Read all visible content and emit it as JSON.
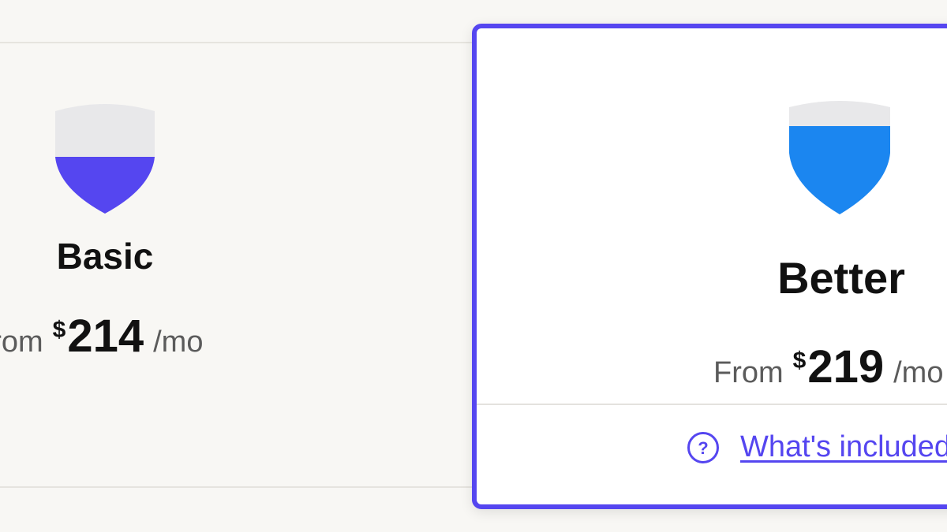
{
  "plans": {
    "basic": {
      "name": "Basic",
      "price_prefix": "From",
      "currency": "$",
      "amount": "214",
      "period": "/mo",
      "shield_fill_fraction": 0.5,
      "shield_color": "#5546f0"
    },
    "better": {
      "name": "Better",
      "price_prefix": "From",
      "currency": "$",
      "amount": "219",
      "period": "/mo",
      "shield_fill_fraction": 0.75,
      "shield_color": "#1b86f0",
      "selected": true,
      "whats_included_label": "What's included"
    }
  },
  "colors": {
    "accent": "#5546f0",
    "better_shield": "#1b86f0",
    "shield_empty": "#e8e8ea",
    "page_bg": "#f8f7f4"
  },
  "icons": {
    "basic_shield": "shield-icon",
    "better_shield": "shield-icon",
    "help": "question-circle-icon"
  }
}
